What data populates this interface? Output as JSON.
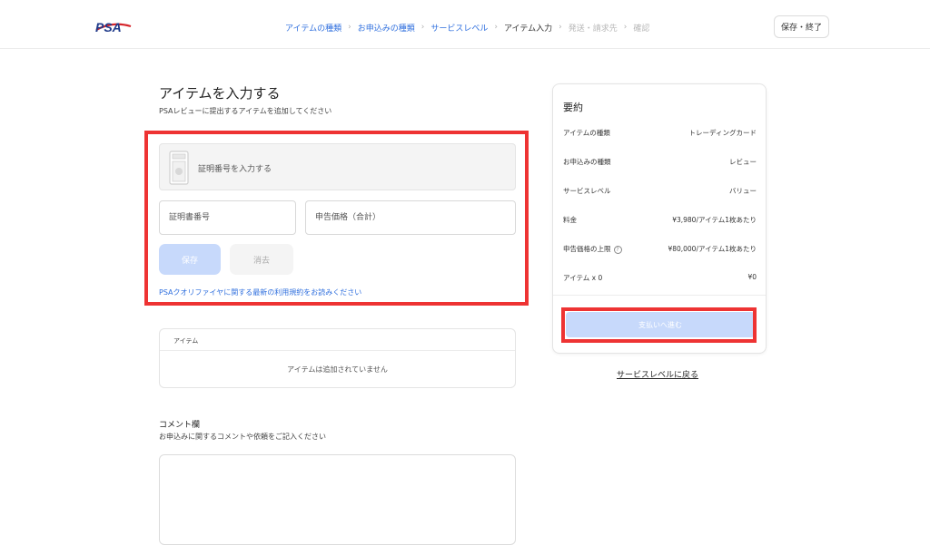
{
  "header": {
    "logo_text": "PSA",
    "breadcrumbs": [
      {
        "label": "アイテムの種類",
        "state": "done"
      },
      {
        "label": "お申込みの種類",
        "state": "done"
      },
      {
        "label": "サービスレベル",
        "state": "done"
      },
      {
        "label": "アイテム入力",
        "state": "current"
      },
      {
        "label": "発送・請求先",
        "state": "future"
      },
      {
        "label": "確認",
        "state": "future"
      }
    ],
    "separator": "›",
    "save_exit_label": "保存・終了"
  },
  "main": {
    "title": "アイテムを入力する",
    "subtitle": "PSAレビューに提出するアイテムを追加してください",
    "cert_entry_label": "証明番号を入力する",
    "cert_number_placeholder": "証明書番号",
    "declared_value_placeholder": "申告価格（合計）",
    "save_label": "保存",
    "clear_label": "消去",
    "terms_link": "PSAクオリファイヤに関する最新の利用規約をお読みください",
    "items_header": "アイテム",
    "items_empty": "アイテムは追加されていません",
    "comment_title": "コメント欄",
    "comment_subtitle": "お申込みに関するコメントや依頼をご記入ください"
  },
  "summary": {
    "title": "要約",
    "rows": [
      {
        "label": "アイテムの種類",
        "value": "トレーディングカード"
      },
      {
        "label": "お申込みの種類",
        "value": "レビュー"
      },
      {
        "label": "サービスレベル",
        "value": "バリュー"
      },
      {
        "label": "料金",
        "value": "¥3,980/アイテム1枚あたり"
      },
      {
        "label": "申告価格の上限",
        "value": "¥80,000/アイテム1枚あたり"
      },
      {
        "label": "アイテム x 0",
        "value": "¥0"
      }
    ],
    "help_symbol": "?",
    "pay_label": "支払いへ進む",
    "back_link": "サービスレベルに戻る"
  },
  "colors": {
    "accent": "#2f6fde",
    "button_disabled": "#c7d9fb",
    "highlight": "#ee3333"
  }
}
